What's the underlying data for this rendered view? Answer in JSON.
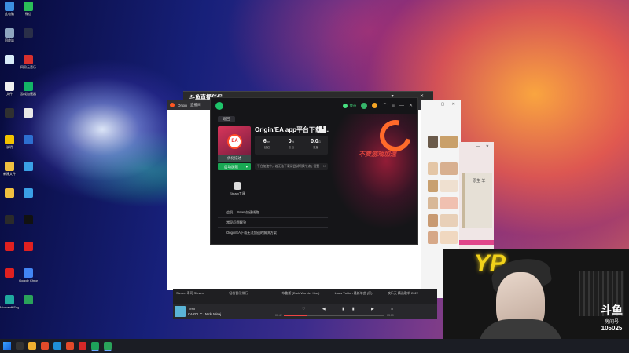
{
  "desktop": {
    "icons": [
      {
        "label": "此电脑",
        "color": "#3c8fe0"
      },
      {
        "label": "微信",
        "color": "#2bbf58"
      },
      {
        "label": "回收站",
        "color": "#8fa6c0"
      },
      {
        "label": "",
        "color": "#2a2f48"
      },
      {
        "label": "",
        "color": "#d9ecf8"
      },
      {
        "label": "网易云音乐",
        "color": "#d8302d"
      },
      {
        "label": "文件",
        "color": "#f0f0f0"
      },
      {
        "label": "游戏加速器",
        "color": "#13b566"
      },
      {
        "label": "",
        "color": "#303030"
      },
      {
        "label": "",
        "color": "#e8e8e8"
      },
      {
        "label": "说明",
        "color": "#f2c200"
      },
      {
        "label": "",
        "color": "#2d6fd0"
      },
      {
        "label": "新建文件",
        "color": "#f0c040"
      },
      {
        "label": "",
        "color": "#3aa0e6"
      },
      {
        "label": "",
        "color": "#f0c040"
      },
      {
        "label": "",
        "color": "#3aa0e6"
      },
      {
        "label": "",
        "color": "#2a2a2a"
      },
      {
        "label": "",
        "color": "#111111"
      },
      {
        "label": "",
        "color": "#e02020"
      },
      {
        "label": "",
        "color": "#e02020"
      },
      {
        "label": "",
        "color": "#e02020"
      },
      {
        "label": "Google Chrome",
        "color": "#4285f4"
      },
      {
        "label": "Microsoft Edge",
        "color": "#1faa9e"
      },
      {
        "label": "",
        "color": "#2aa35a"
      }
    ]
  },
  "back_window": {
    "title": "斗鱼直播伴侣",
    "controls": "▾ — ✕"
  },
  "browser": {
    "tab": "Origin",
    "tab2": "直播间"
  },
  "ea_app": {
    "vip_label": "会员",
    "back_label": "返回",
    "title": "Origin/EA app平台下载|...",
    "slogan": "不卖游戏加速",
    "cover_logo": "EA",
    "desc_button": "优化描述",
    "launch_button": "启动加速",
    "stats": [
      {
        "value": "6",
        "unit": "ms",
        "label": "延迟"
      },
      {
        "value": "0",
        "unit": "%",
        "label": "丢包"
      },
      {
        "value": "0.0",
        "unit": "G",
        "label": "流量"
      }
    ],
    "notice": "平台加速中，若无法下载请尝试切换节点 | 设置",
    "tool_label": "Steam工具",
    "lines": [
      "会员、Steam加速线路",
      "常见问题解答",
      "Origin/EA下载无法加速的解决方案"
    ]
  },
  "music": {
    "columns": [
      "Steven 寿司 Steven",
      "轻松音乐排行",
      "布鲁斯 (Dark Wonder Kiss)",
      "Louis Vuitton 最新单曲 (原)",
      "欢乐天 精选歌单 2022"
    ],
    "song": "Tired",
    "artist": "CAROL C / Nicki Minaj",
    "controls": "♡ ◀ ▮▮ ▶ ≡",
    "time_start": "00:42",
    "time_end": "03:09",
    "progress": 0.24
  },
  "stream": {
    "sign": "YP",
    "brand": "斗鱼",
    "room_label": "房间号",
    "room_number": "105025"
  },
  "right_win": {
    "controls": "— ▢ ✕"
  },
  "third_win": {
    "controls": "— ✕",
    "panel_text": "原生 羊"
  }
}
